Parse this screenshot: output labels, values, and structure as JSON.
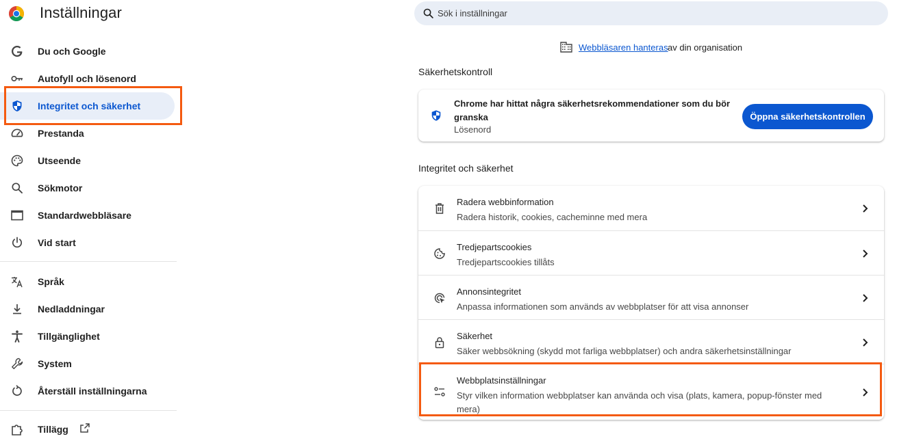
{
  "header": {
    "title": "Inställningar",
    "logo_icon": "chrome-logo",
    "search_placeholder": "Sök i inställningar"
  },
  "sidebar": {
    "items": [
      {
        "label": "Du och Google",
        "icon": "google-g-icon"
      },
      {
        "label": "Autofyll och lösenord",
        "icon": "key-icon"
      },
      {
        "label": "Integritet och säkerhet",
        "icon": "shield-icon",
        "active": true
      },
      {
        "label": "Prestanda",
        "icon": "speedometer-icon"
      },
      {
        "label": "Utseende",
        "icon": "palette-icon"
      },
      {
        "label": "Sökmotor",
        "icon": "search-icon"
      },
      {
        "label": "Standardwebbläsare",
        "icon": "browser-window-icon"
      },
      {
        "label": "Vid start",
        "icon": "power-icon"
      },
      {
        "label": "Språk",
        "icon": "translate-icon"
      },
      {
        "label": "Nedladdningar",
        "icon": "download-icon"
      },
      {
        "label": "Tillgänglighet",
        "icon": "accessibility-icon"
      },
      {
        "label": "System",
        "icon": "wrench-icon"
      },
      {
        "label": "Återställ inställningarna",
        "icon": "reset-icon"
      },
      {
        "label": "Tillägg",
        "icon": "puzzle-icon"
      }
    ]
  },
  "managed": {
    "link": "Webbläsaren hanteras",
    "rest": "av din organisation",
    "icon": "building-icon"
  },
  "safety_check": {
    "section_title": "Säkerhetskontroll",
    "message": "Chrome har hittat några säkerhetsrekommendationer som du bör granska",
    "sub": "Lösenord",
    "button": "Öppna säkerhetskontrollen",
    "icon": "shield-icon"
  },
  "privacy": {
    "section_title": "Integritet och säkerhet",
    "rows": [
      {
        "title": "Radera webbinformation",
        "sub": "Radera historik, cookies, cacheminne med mera",
        "icon": "trash-icon"
      },
      {
        "title": "Tredjepartscookies",
        "sub": "Tredjepartscookies tillåts",
        "icon": "cookie-icon"
      },
      {
        "title": "Annonsintegritet",
        "sub": "Anpassa informationen som används av webbplatser för att visa annonser",
        "icon": "ad-privacy-icon"
      },
      {
        "title": "Säkerhet",
        "sub": "Säker webbsökning (skydd mot farliga webbplatser) och andra säkerhetsinställningar",
        "icon": "lock-icon"
      },
      {
        "title": "Webbplatsinställningar",
        "sub": "Styr vilken information webbplatser kan använda och visa (plats, kamera, popup-fönster med mera)",
        "icon": "sliders-icon"
      }
    ]
  },
  "colors": {
    "accent": "#0b57d0",
    "active_bg": "#e8eef8",
    "highlight": "#f45a10",
    "search_bg": "#e9eef6"
  }
}
